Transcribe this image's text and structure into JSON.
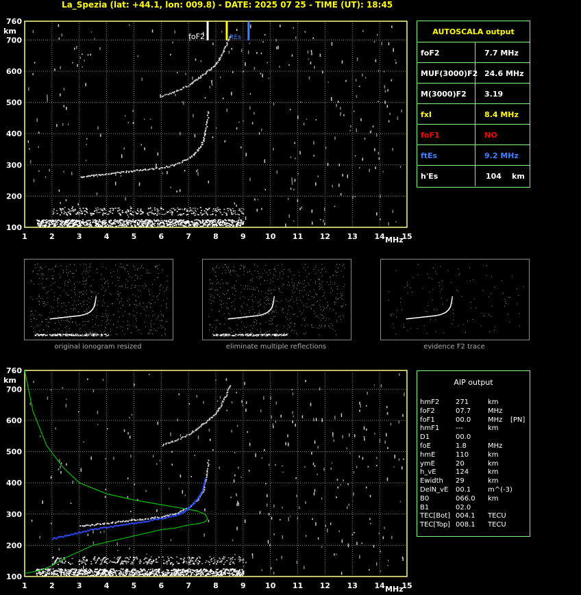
{
  "title": "La_Spezia (lat: +44.1, lon: 009.8) - DATE: 2025 07 25 - TIME (UT): 18:45",
  "colors": {
    "grid": "#888888",
    "axis": "#ffff80",
    "trace": "#ffffff",
    "box": "#7fff7f",
    "yellow": "#ffff00",
    "blue": "#4080ff",
    "red": "#ff0000",
    "green": "#00c000"
  },
  "chart_data": [
    {
      "type": "scatter",
      "xlabel": "MHz",
      "ylabel": "km",
      "xlim": [
        1,
        15
      ],
      "ylim": [
        100,
        760
      ],
      "xticks": [
        1,
        2,
        3,
        4,
        5,
        6,
        7,
        8,
        9,
        10,
        11,
        12,
        13,
        14,
        15
      ],
      "yticks": [
        100,
        200,
        300,
        400,
        500,
        600,
        700,
        760
      ],
      "markers": [
        {
          "label": "foF2",
          "x": 7.7,
          "color": "#ffffff"
        },
        {
          "label": "fxI",
          "x": 8.4,
          "color": "#ffff00"
        },
        {
          "label": "ftEs",
          "x": 9.2,
          "color": "#4080ff"
        }
      ],
      "ordinary_trace": {
        "x": [
          3,
          3.5,
          4,
          4.5,
          5,
          5.5,
          6,
          6.5,
          7,
          7.3,
          7.5,
          7.6,
          7.7
        ],
        "y": [
          265,
          270,
          275,
          280,
          285,
          290,
          295,
          305,
          325,
          350,
          380,
          420,
          480
        ]
      },
      "extraord_trace": {
        "x": [
          6,
          6.5,
          7,
          7.3,
          7.6,
          7.9,
          8.1,
          8.3,
          8.5
        ],
        "y": [
          525,
          540,
          560,
          580,
          600,
          620,
          645,
          680,
          720
        ]
      },
      "es_layer": {
        "x": [
          1.4,
          9
        ],
        "y": [
          104,
          160
        ]
      }
    },
    {
      "type": "line",
      "xlabel": "MHz",
      "ylabel": "km",
      "xlim": [
        1,
        15
      ],
      "ylim": [
        100,
        760
      ],
      "xticks": [
        1,
        2,
        3,
        4,
        5,
        6,
        7,
        8,
        9,
        10,
        11,
        12,
        13,
        14,
        15
      ],
      "yticks": [
        100,
        200,
        300,
        400,
        500,
        600,
        700,
        760
      ],
      "profile": {
        "x": [
          1.0,
          1.3,
          1.6,
          2.0,
          2.5,
          3.0,
          3.5,
          4.0,
          4.5,
          5.0,
          5.5,
          6.0,
          6.5,
          7.0,
          7.4,
          7.6,
          7.7,
          7.6,
          7.3,
          6.8,
          6.0,
          5.0,
          4.0,
          3.0,
          2.4,
          1.8,
          1.3,
          1.0
        ],
        "y": [
          110,
          115,
          120,
          135,
          160,
          180,
          200,
          210,
          220,
          230,
          240,
          250,
          255,
          265,
          270,
          275,
          285,
          300,
          310,
          318,
          330,
          345,
          365,
          400,
          450,
          520,
          630,
          760
        ]
      },
      "aip_trace": {
        "x": [
          2,
          2.5,
          3,
          3.5,
          4,
          4.5,
          5,
          5.5,
          6,
          6.5,
          6.8,
          7.0,
          7.3,
          7.5,
          7.6
        ],
        "y": [
          225,
          235,
          245,
          255,
          262,
          268,
          275,
          282,
          290,
          300,
          310,
          325,
          350,
          380,
          420
        ]
      }
    }
  ],
  "autoscala": {
    "header": "AUTOSCALA output",
    "rows": [
      {
        "label": "foF2",
        "value": "7.7 MHz",
        "color": "#ffffff"
      },
      {
        "label": "MUF(3000)F2",
        "value": "24.6 MHz",
        "color": "#ffffff"
      },
      {
        "label": "M(3000)F2",
        "value": "3.19",
        "color": "#ffffff"
      },
      {
        "label": "fxI",
        "value": "8.4 MHz",
        "color": "#ffff00"
      },
      {
        "label": "foF1",
        "value": "NO",
        "color": "#ff0000"
      },
      {
        "label": "ftEs",
        "value": "9.2 MHz",
        "color": "#4080ff"
      },
      {
        "label": "h'Es",
        "value": "104",
        "unit": "km",
        "color": "#ffffff"
      }
    ]
  },
  "captions": [
    "original ionogram resized",
    "eliminate multiple reflections",
    "evidence F2 trace"
  ],
  "aip": {
    "header": "AIP output",
    "rows": [
      [
        "hmF2",
        "271",
        "km",
        ""
      ],
      [
        "foF2",
        "07.7",
        "MHz",
        ""
      ],
      [
        "foF1",
        "00.0",
        "MHz",
        "[PN]"
      ],
      [
        "hmF1",
        "---",
        "km",
        ""
      ],
      [
        "D1",
        "00.0",
        "",
        ""
      ],
      [
        "foE",
        "1.8",
        "MHz",
        ""
      ],
      [
        "hmE",
        "110",
        "km",
        ""
      ],
      [
        "ymE",
        "20",
        "km",
        ""
      ],
      [
        "h_vE",
        "124",
        "km",
        ""
      ],
      [
        "Ewidth",
        "29",
        "km",
        ""
      ],
      [
        "DelN_vE",
        "00.1",
        "m^(-3)",
        ""
      ],
      [
        "B0",
        "066.0",
        "km",
        ""
      ],
      [
        "B1",
        "02.0",
        "",
        ""
      ],
      [
        "TEC[Bot]",
        "004.1",
        "TECU",
        ""
      ],
      [
        "TEC[Top]",
        "008.1",
        "TECU",
        ""
      ]
    ]
  }
}
